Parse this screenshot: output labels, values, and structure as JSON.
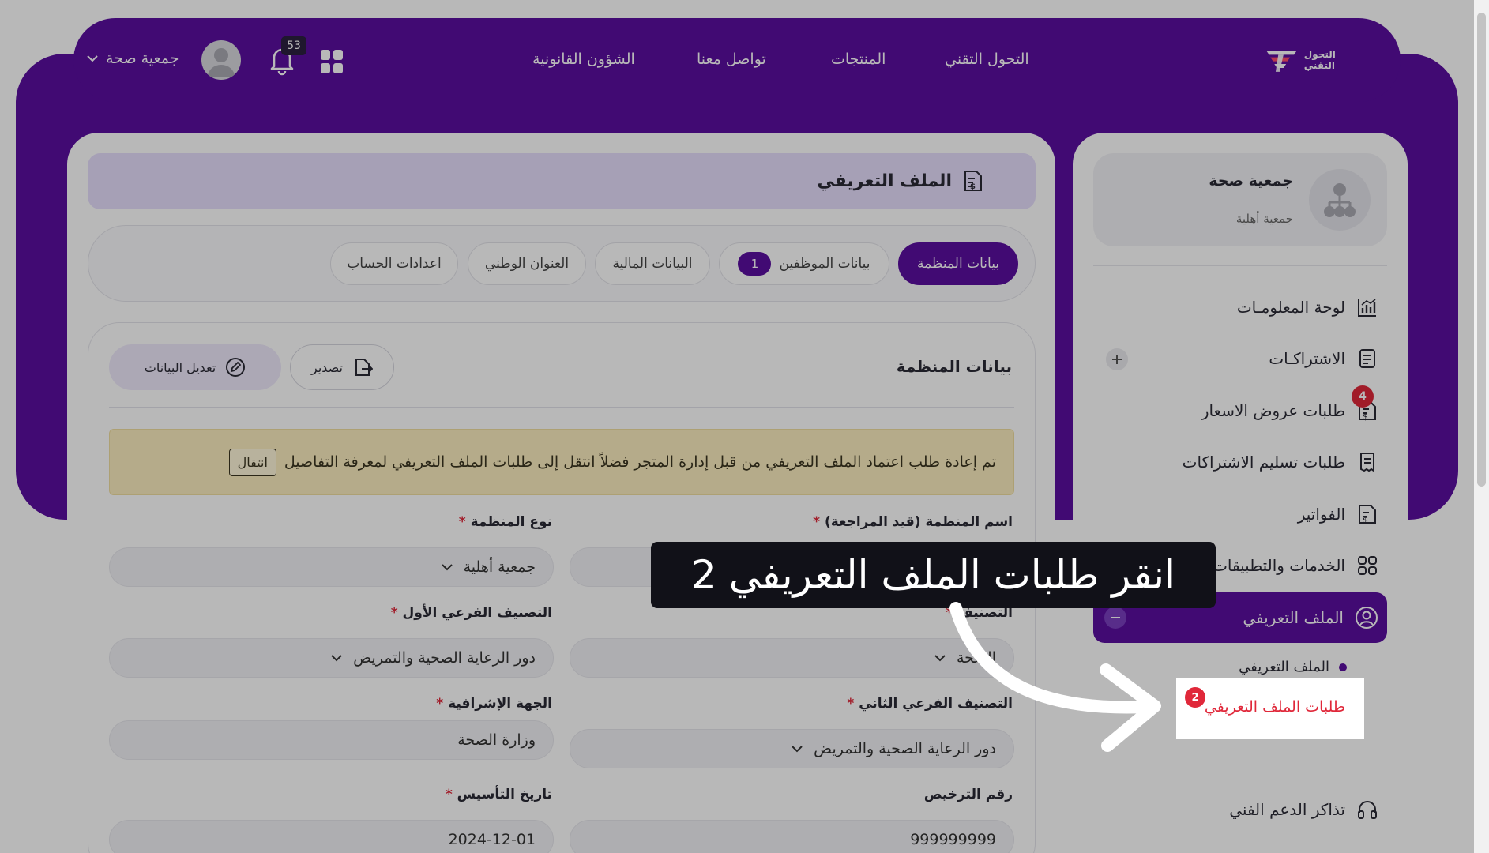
{
  "header": {
    "brand_text": "التحول التقني",
    "nav": [
      "التحول التقني",
      "المنتجات",
      "تواصل معنا",
      "الشؤون القانونية"
    ],
    "notifications_count": "53",
    "user_name": "جمعية صحة"
  },
  "sidebar": {
    "org_name": "جمعية صحة",
    "org_type": "جمعية أهلية",
    "items": [
      {
        "label": "لوحة المعلومـات",
        "icon": "chart-icon"
      },
      {
        "label": "الاشتراكـات",
        "icon": "document-icon"
      },
      {
        "label": "طلبات عروض الاسعار",
        "icon": "invoice-icon",
        "badge": "4"
      },
      {
        "label": "طلبات تسليم الاشتراكات",
        "icon": "receipt-icon"
      },
      {
        "label": "الفواتير",
        "icon": "invoice-icon"
      },
      {
        "label": "الخدمات والتطبيقات",
        "icon": "grid-icon"
      },
      {
        "label": "الملف التعريفي",
        "icon": "user-circle-icon"
      },
      {
        "label": "تذاكر الدعم الفني",
        "icon": "headset-icon"
      }
    ],
    "sub_items": [
      {
        "label": "الملف التعريفي"
      },
      {
        "label": "طلبات الملف التعريفي",
        "badge": "2"
      }
    ]
  },
  "main": {
    "page_title": "الملف التعريفي",
    "tabs": [
      {
        "label": "بيانات المنظمة",
        "active": true
      },
      {
        "label": "بيانات الموظفين",
        "count": "1"
      },
      {
        "label": "البيانات المالية"
      },
      {
        "label": "العنوان الوطني"
      },
      {
        "label": "اعدادات الحساب"
      }
    ],
    "section_title": "بيانات المنظمة",
    "export_label": "تصدير",
    "edit_label": "تعديل البيانات",
    "alert_text": "تم إعادة طلب اعتماد الملف التعريفي من قبل إدارة المتجر فضلاً انتقل إلى طلبات الملف التعريفي لمعرفة التفاصيل",
    "alert_button": "انتقال",
    "fields": {
      "org_name_label": "اسم المنظمة (قيد المراجعة)",
      "org_type_label": "نوع المنظمة",
      "org_type_value": "جمعية أهلية",
      "classification_label": "التصنيف",
      "classification_value": "الصحة",
      "sub1_label": "التصنيف الفرعي الأول",
      "sub1_value": "دور الرعاية الصحية والتمريض",
      "sub2_label": "التصنيف الفرعي الثاني",
      "sub2_value": "دور الرعاية الصحية والتمريض",
      "supervisor_label": "الجهة الإشرافية",
      "supervisor_value": "وزارة الصحة",
      "license_label": "رقم الترخيص",
      "license_value": "999999999",
      "founded_label": "تاريخ التأسيس",
      "founded_value": "2024-12-01",
      "required_mark": "*"
    }
  },
  "overlay": {
    "tooltip_text": "انقر طلبات الملف التعريفي 2"
  },
  "colors": {
    "brand_purple": "#5a0ea0",
    "badge_red": "#e0283a",
    "alert_bg": "#fbeec0"
  }
}
